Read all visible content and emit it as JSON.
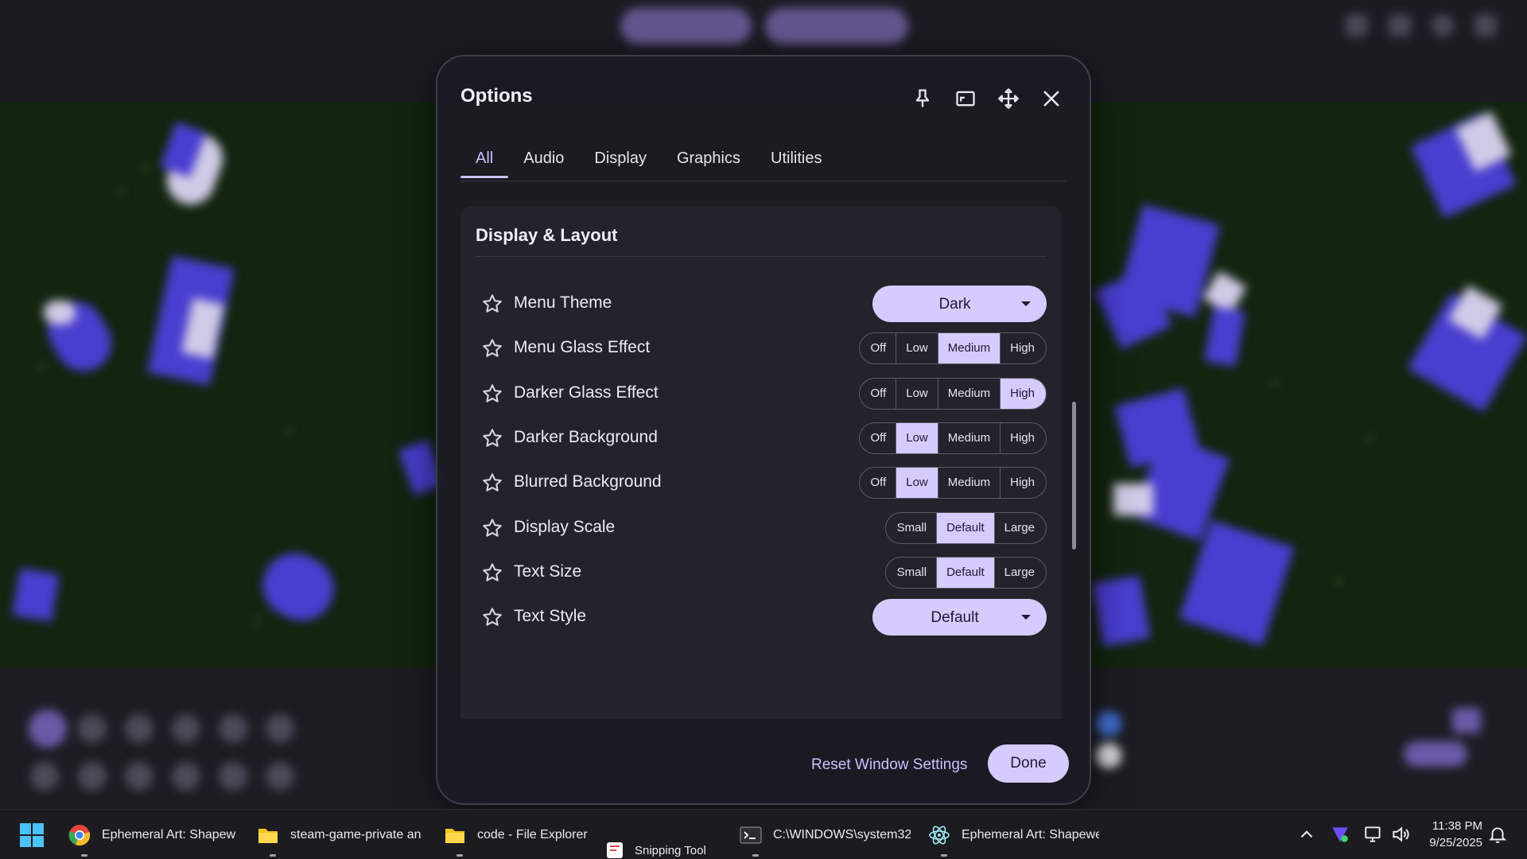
{
  "dialog": {
    "title": "Options",
    "header_icons": [
      "pin-icon",
      "window-mode-icon",
      "move-icon",
      "close-icon"
    ],
    "tabs": [
      {
        "label": "All",
        "active": true
      },
      {
        "label": "Audio",
        "active": false
      },
      {
        "label": "Display",
        "active": false
      },
      {
        "label": "Graphics",
        "active": false
      },
      {
        "label": "Utilities",
        "active": false
      }
    ],
    "section": {
      "title": "Display & Layout",
      "rows": [
        {
          "label": "Menu Theme",
          "type": "dropdown",
          "value": "Dark"
        },
        {
          "label": "Menu Glass Effect",
          "type": "segmented",
          "options": [
            "Off",
            "Low",
            "Medium",
            "High"
          ],
          "selected": "Medium"
        },
        {
          "label": "Darker Glass Effect",
          "type": "segmented",
          "options": [
            "Off",
            "Low",
            "Medium",
            "High"
          ],
          "selected": "High"
        },
        {
          "label": "Darker Background",
          "type": "segmented",
          "options": [
            "Off",
            "Low",
            "Medium",
            "High"
          ],
          "selected": "Low"
        },
        {
          "label": "Blurred Background",
          "type": "segmented",
          "options": [
            "Off",
            "Low",
            "Medium",
            "High"
          ],
          "selected": "Low"
        },
        {
          "label": "Display Scale",
          "type": "segmented",
          "options": [
            "Small",
            "Default",
            "Large"
          ],
          "selected": "Default"
        },
        {
          "label": "Text Size",
          "type": "segmented",
          "options": [
            "Small",
            "Default",
            "Large"
          ],
          "selected": "Default"
        },
        {
          "label": "Text Style",
          "type": "dropdown",
          "value": "Default"
        }
      ]
    },
    "footer": {
      "reset_label": "Reset Window Settings",
      "done_label": "Done"
    }
  },
  "taskbar": {
    "items": [
      {
        "label": "Ephemeral Art: Shapewe",
        "icon": "chrome-icon"
      },
      {
        "label": "steam-game-private an",
        "icon": "folder-icon"
      },
      {
        "label": "code - File Explorer",
        "icon": "folder-icon"
      },
      {
        "label": "C:\\WINDOWS\\system32",
        "icon": "terminal-icon"
      },
      {
        "label": "Ephemeral Art: Shapewe",
        "icon": "electron-icon"
      }
    ],
    "snipping_tool_label": "Snipping Tool",
    "clock": {
      "time": "11:38 PM",
      "date": "9/25/2025"
    }
  },
  "colors": {
    "accent": "#d6cbff",
    "accent_text": "#ccc0ff",
    "dialog_bg": "#1c1b23",
    "panel_bg": "#24232b",
    "canvas_bg": "#13240f",
    "shape_blue": "#4a3ed0"
  }
}
